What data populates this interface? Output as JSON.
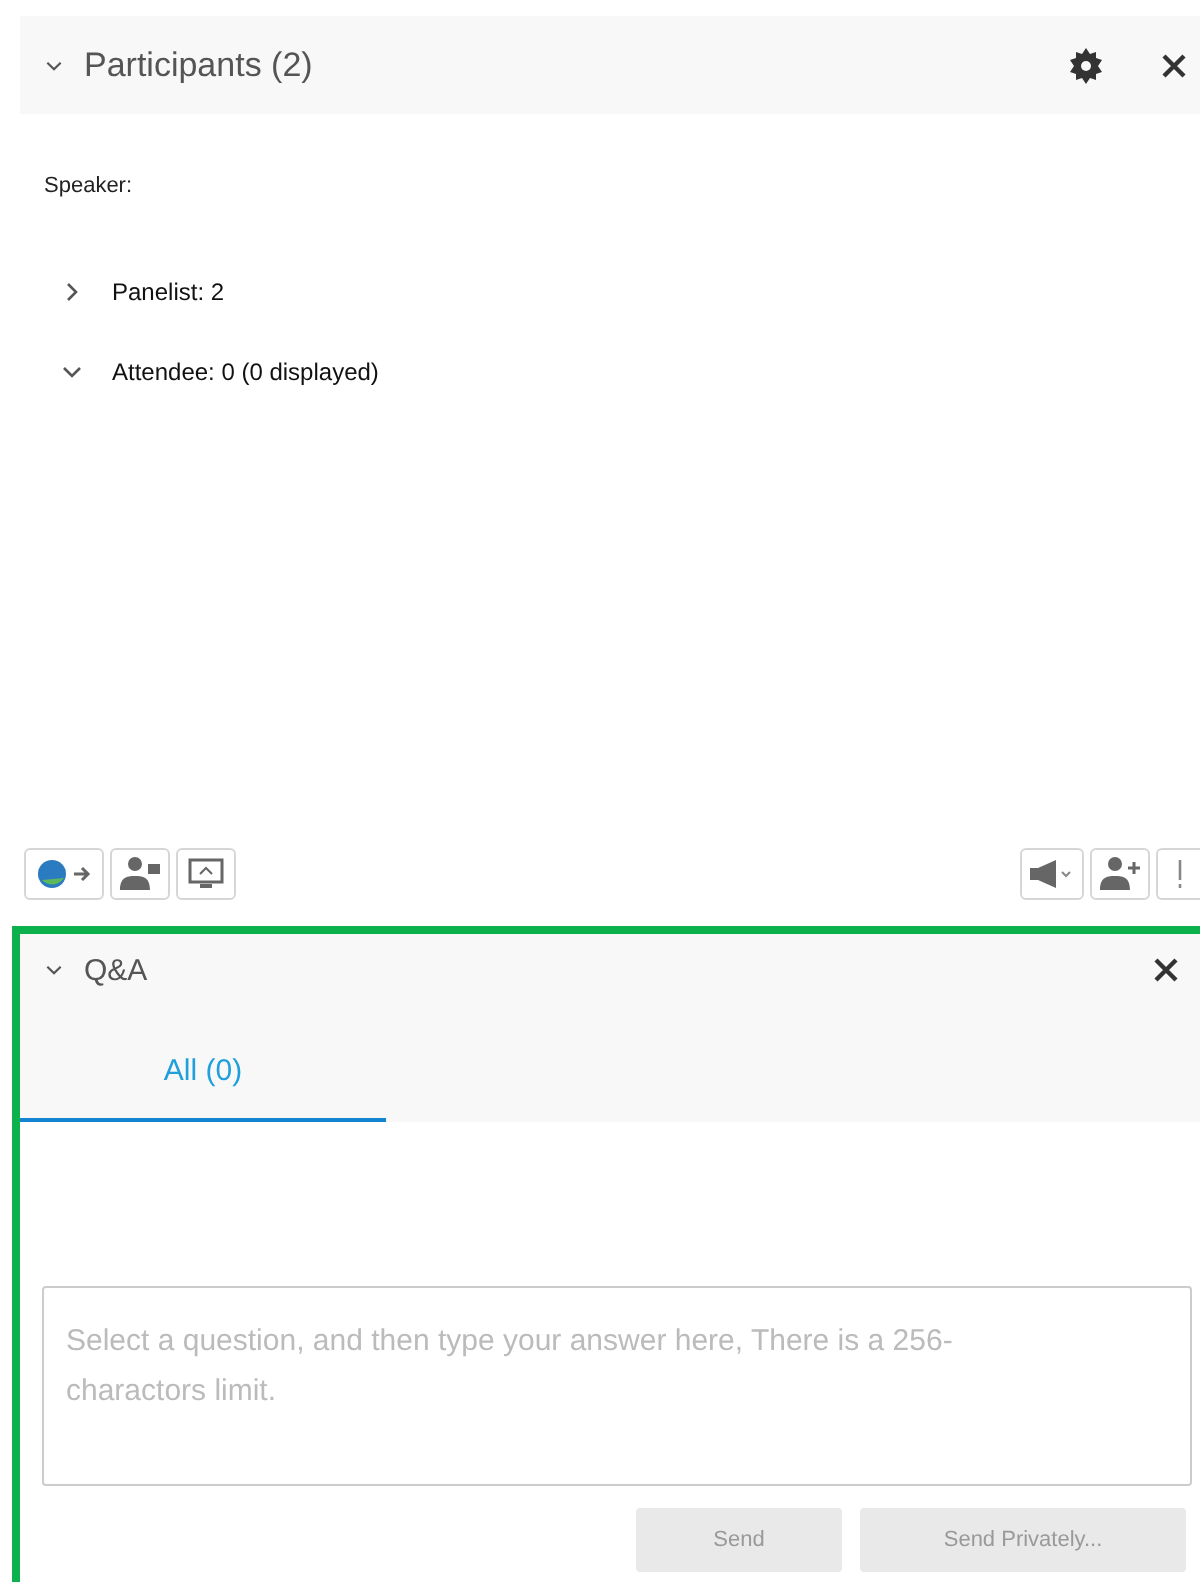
{
  "participants_panel": {
    "title": "Participants (2)",
    "expanded": true,
    "speaker_label": "Speaker:",
    "groups": [
      {
        "label": "Panelist: 2",
        "expanded": false
      },
      {
        "label": "Attendee: 0 (0 displayed)",
        "expanded": true
      }
    ]
  },
  "qa_panel": {
    "title": "Q&A",
    "expanded": true,
    "tabs": [
      {
        "label": "All (0)",
        "selected": true
      }
    ],
    "answer": {
      "placeholder": "Select a question, and then type your answer here, There is a 256-charactors limit."
    },
    "buttons": [
      {
        "label": "Send",
        "disabled": true
      },
      {
        "label": "Send Privately...",
        "disabled": true
      }
    ]
  }
}
